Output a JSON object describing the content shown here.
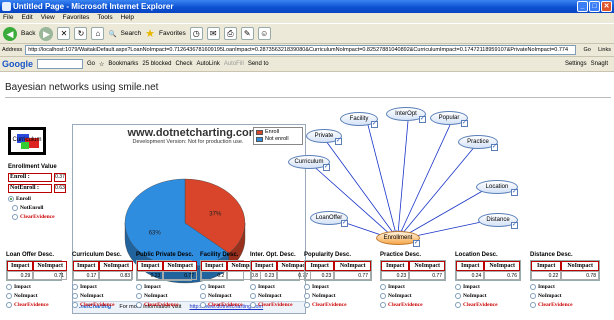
{
  "window": {
    "title": "Untitled Page - Microsoft Internet Explorer",
    "buttons": [
      "_",
      "□",
      "✕"
    ]
  },
  "menu": [
    "File",
    "Edit",
    "View",
    "Favorites",
    "Tools",
    "Help"
  ],
  "toolbar": {
    "back_label": "Back",
    "search_label": "Search",
    "favorites_label": "Favorites"
  },
  "address": {
    "label": "Address",
    "url": "http://localhost:1079/WaitakiDefault.aspx?LoanNoImpact=0.7126436781609195LoanImpact=0.287356321839080&CurriculumNoImpact=0.82527881040892&CurriculumImpact=0.17472118959107&PrivateNoImpact=0.774",
    "go": "Go",
    "links": "Links"
  },
  "google": {
    "logo": "Google",
    "go": "Go",
    "bookmarks": "Bookmarks",
    "blocked": "25 blocked",
    "check": "Check",
    "autolink": "AutoLink",
    "autofill": "AutoFill",
    "sendto": "Send to",
    "settings": "Settings",
    "snagit": "SnagIt"
  },
  "page": {
    "title": "Bayesian networks using smile.net",
    "thumb_label": "Curriculum"
  },
  "enrollment": {
    "title": "Enrollment Value",
    "rows": [
      {
        "label": "Enroll :",
        "value": "0.37"
      },
      {
        "label": "NotEnroll :",
        "value": "0.63"
      }
    ],
    "options": [
      {
        "label": "Enroll",
        "checked": true,
        "red": false
      },
      {
        "label": "NotEnroll",
        "checked": false,
        "red": false
      },
      {
        "label": "ClearEvidence",
        "checked": false,
        "red": true
      }
    ]
  },
  "chart": {
    "site": "www.dotnetcharting.com",
    "subtitle": "Development Version: Not for production use.",
    "footer_logo": ".netCharting",
    "footer_info": "For more information visit",
    "footer_link": "http://www.dotnetcharting.com"
  },
  "chart_data": {
    "type": "pie",
    "categories": [
      "Enroll",
      "Not enroll"
    ],
    "values": [
      37,
      63
    ],
    "colors": [
      "#d8452a",
      "#2f8de0"
    ],
    "labels": [
      "37%",
      "63%"
    ],
    "legend_position": "top-right"
  },
  "network": {
    "nodes": [
      {
        "id": "facility",
        "label": "Facility"
      },
      {
        "id": "interopt",
        "label": "InterOpt"
      },
      {
        "id": "popular",
        "label": "Popular"
      },
      {
        "id": "private",
        "label": "Private"
      },
      {
        "id": "practice",
        "label": "Practice"
      },
      {
        "id": "curriculum",
        "label": "Curriculum"
      },
      {
        "id": "location",
        "label": "Location"
      },
      {
        "id": "loanoffer",
        "label": "LoanOffer"
      },
      {
        "id": "distance",
        "label": "Distance"
      },
      {
        "id": "enrollment",
        "label": "Enrollment"
      }
    ]
  },
  "descriptors": [
    {
      "title": "Loan Offer Desc.",
      "impact": "0.29",
      "noimpact": "0.71"
    },
    {
      "title": "Curriculum Desc.",
      "impact": "0.17",
      "noimpact": "0.83"
    },
    {
      "title": "Public Private Desc.",
      "impact": "0.23",
      "noimpact": "0.77"
    },
    {
      "title": "Facility Desc.",
      "impact": "0.2",
      "noimpact": "0.8"
    },
    {
      "title": "Inter. Opt. Desc.",
      "impact": "0.23",
      "noimpact": "0.77"
    },
    {
      "title": "Popularity Desc.",
      "impact": "0.23",
      "noimpact": "0.77"
    },
    {
      "title": "Practice Desc.",
      "impact": "0.23",
      "noimpact": "0.77"
    },
    {
      "title": "Location Desc.",
      "impact": "0.24",
      "noimpact": "0.76"
    },
    {
      "title": "Distance Desc.",
      "impact": "0.22",
      "noimpact": "0.78"
    }
  ],
  "descriptor_labels": {
    "impact": "Impact",
    "noimpact": "NoImpact",
    "clear": "ClearEvidence"
  }
}
